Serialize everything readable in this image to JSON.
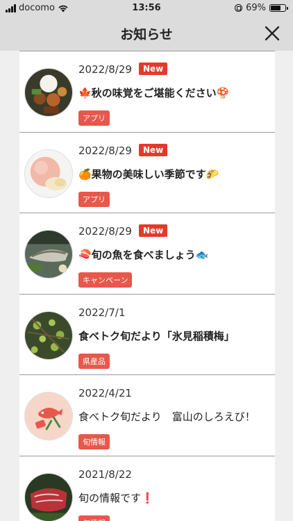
{
  "status_bar": {
    "carrier": "docomo",
    "time": "13:56",
    "battery_percent": "69%",
    "battery_level": 0.69
  },
  "header": {
    "title": "お知らせ",
    "close_icon": "close-icon"
  },
  "items": [
    {
      "date": "2022/8/29",
      "badge": "New",
      "title": "🍁秋の味覚をご堪能ください🍄",
      "tag": "アプリ",
      "thumb_icon": "autumn-food-thumbnail",
      "bold": true
    },
    {
      "date": "2022/8/29",
      "badge": "New",
      "title": "🍊果物の美味しい季節です🌮",
      "tag": "アプリ",
      "thumb_icon": "peach-thumbnail",
      "bold": true
    },
    {
      "date": "2022/8/29",
      "badge": "New",
      "title": "🍣旬の魚を食べましょう🐟",
      "tag": "キャンペーン",
      "thumb_icon": "grilled-fish-thumbnail",
      "bold": true
    },
    {
      "date": "2022/7/1",
      "badge": "",
      "title": "食ベトク旬だより「氷見稲積梅」",
      "tag": "県産品",
      "thumb_icon": "ume-plum-thumbnail",
      "bold": true
    },
    {
      "date": "2022/4/21",
      "badge": "",
      "title": "食べトク旬だより　富山のしろえび！",
      "tag": "旬情報",
      "thumb_icon": "food-logo-thumbnail",
      "bold": false
    },
    {
      "date": "2021/8/22",
      "badge": "",
      "title": "旬の情報です❗",
      "tag": "旬情報",
      "thumb_icon": "beef-thumbnail",
      "bold": false
    }
  ]
}
